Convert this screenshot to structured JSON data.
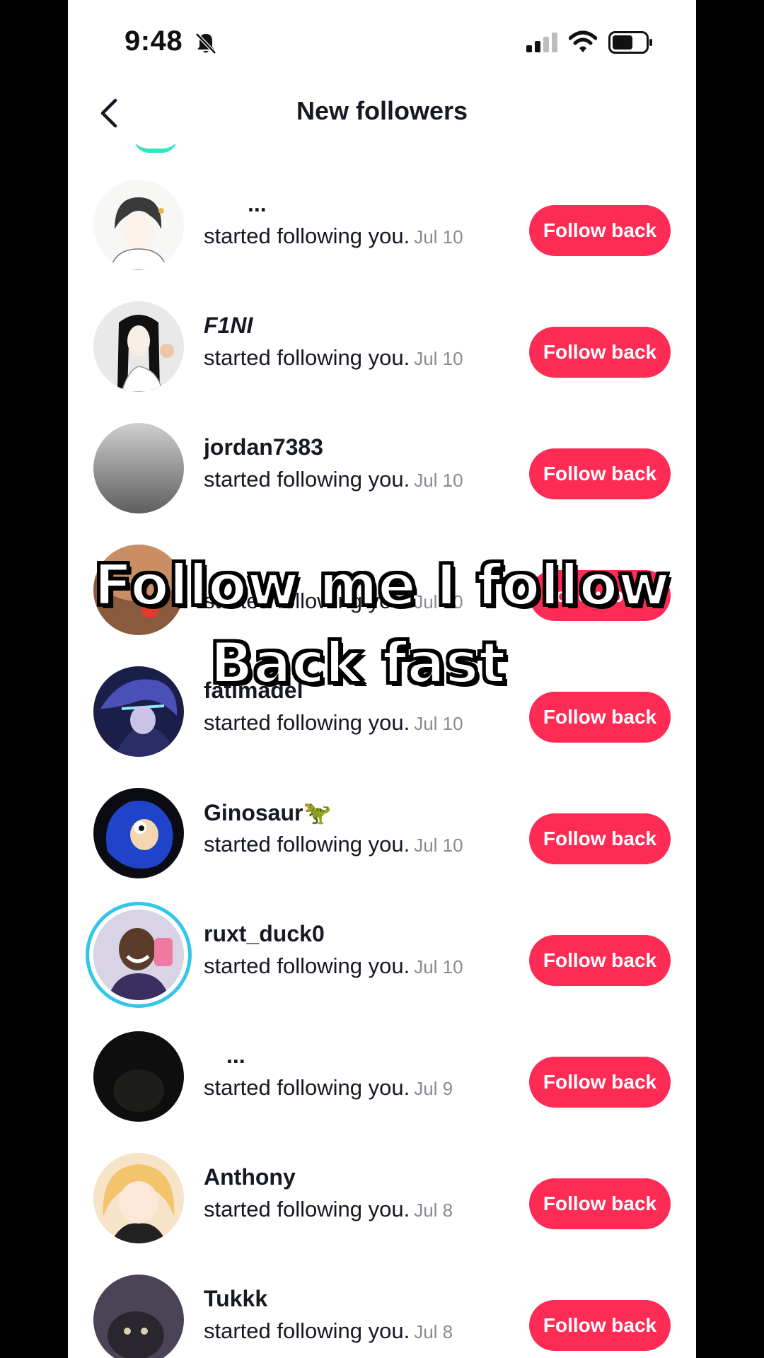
{
  "status_bar": {
    "time": "9:48",
    "icons": [
      "bell-slash-icon",
      "cellular-signal-icon",
      "wifi-icon",
      "battery-icon"
    ]
  },
  "header": {
    "back_icon": "chevron-left-icon",
    "title": "New followers"
  },
  "colors": {
    "accent": "#fe2c55",
    "text": "#161823",
    "muted": "#8a8b91",
    "story_ring": "#33c6e8"
  },
  "followers": [
    {
      "username": "...",
      "action": "started following you.",
      "date": "Jul 10",
      "button": "Follow back"
    },
    {
      "username": "F1NI",
      "action": "started following you.",
      "date": "Jul 10",
      "button": "Follow back"
    },
    {
      "username": "jordan7383",
      "action": "started following you.",
      "date": "Jul 10",
      "button": "Follow back"
    },
    {
      "username": "",
      "action": "started following you.",
      "date": "Jul 10",
      "button": "Follow back"
    },
    {
      "username": "fatimadel",
      "action": "started following you.",
      "date": "Jul 10",
      "button": "Follow back"
    },
    {
      "username": "Ginosaur🦖",
      "action": "started following you.",
      "date": "Jul 10",
      "button": "Follow back"
    },
    {
      "username": "ruxt_duck0",
      "action": "started following you.",
      "date": "Jul 10",
      "button": "Follow back"
    },
    {
      "username": "...",
      "action": "started following you.",
      "date": "Jul 9",
      "button": "Follow back"
    },
    {
      "username": "Anthony",
      "action": "started following you.",
      "date": "Jul 8",
      "button": "Follow back"
    },
    {
      "username": "Tukkk",
      "action": "started following you.",
      "date": "Jul 8",
      "button": "Follow back"
    }
  ],
  "overlay": {
    "line1": "Follow me I follow",
    "line2": "Back fast"
  }
}
